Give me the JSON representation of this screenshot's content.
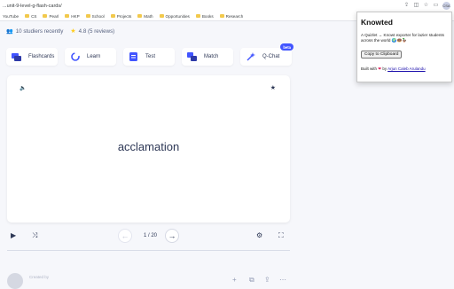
{
  "browser": {
    "url": "...unit-9-level-g-flash-cards/",
    "profile_initials": "CSA",
    "bookmarks": [
      "YouTube",
      "CS",
      "Pearl",
      "HKP",
      "School",
      "Projects",
      "Math",
      "Opportunities",
      "Books",
      "Research"
    ]
  },
  "stats": {
    "studiers": "10 studiers recently",
    "rating": "4.8 (5 reviews)"
  },
  "modes": [
    {
      "label": "Flashcards",
      "icon": "flashcards-icon"
    },
    {
      "label": "Learn",
      "icon": "learn-icon"
    },
    {
      "label": "Test",
      "icon": "test-icon"
    },
    {
      "label": "Match",
      "icon": "match-icon"
    },
    {
      "label": "Q-Chat",
      "icon": "qchat-icon",
      "badge": "beta"
    }
  ],
  "card": {
    "term": "acclamation"
  },
  "controls": {
    "counter": "1 / 20"
  },
  "bottom": {
    "creator_name": "Created by"
  },
  "extension": {
    "title": "Knowted",
    "description": "A Quizlet → Knowt exporter for lazier students across the world 🌍🍩🦆",
    "copy_button": "Copy to Clipboard",
    "built_prefix": "Built with",
    "built_by": "by",
    "author": "Arjun Caleb Arulandu"
  },
  "colors": {
    "accent": "#4255ff",
    "text": "#2e3856",
    "star": "#ffcd1f"
  }
}
